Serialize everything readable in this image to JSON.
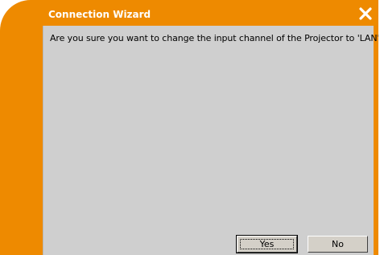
{
  "window": {
    "title": "Connection Wizard",
    "frame_color": "#ee8a00",
    "content_color": "#cfcfcf",
    "close_icon": "close-x-icon"
  },
  "dialog": {
    "message": "Are you sure you want to change the input channel of the Projector to 'LAN'?",
    "yes_label": "Yes",
    "no_label": "No"
  }
}
